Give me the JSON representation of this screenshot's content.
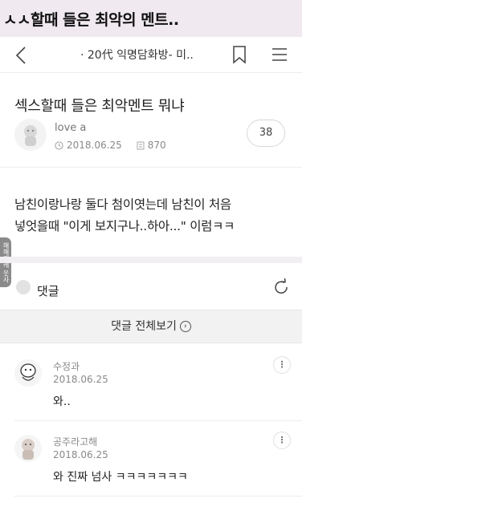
{
  "banner": {
    "text": "ㅅㅅ할때 들은 최악의 멘트.."
  },
  "topbar": {
    "room_title": "· 20代 익명담화방- 미.."
  },
  "post": {
    "title": "섹스할때 들은 최악멘트 뭐냐",
    "author": "love a",
    "date": "2018.06.25",
    "views": "870",
    "comment_count": "38",
    "body_line1": "남친이랑나랑 둘다 첨이엿는데 남친이 처음",
    "body_line2": "넣엇을때 \"이게 보지구나..하아...\" 이럼ㅋㅋ"
  },
  "side_tab": {
    "text": "해해캐캐 웃사"
  },
  "comments_section": {
    "label": "댓글",
    "see_all": "댓글 전체보기"
  },
  "comments": [
    {
      "name": "수정과",
      "date": "2018.06.25",
      "text": "와.."
    },
    {
      "name": "공주라고해",
      "date": "2018.06.25",
      "text": "와 진짜 넘사 ㅋㅋㅋㅋㅋㅋㅋ"
    }
  ],
  "icons": [
    "back-icon",
    "bookmark-icon",
    "menu-icon",
    "clock-icon",
    "views-icon",
    "refresh-icon",
    "more-icon"
  ]
}
